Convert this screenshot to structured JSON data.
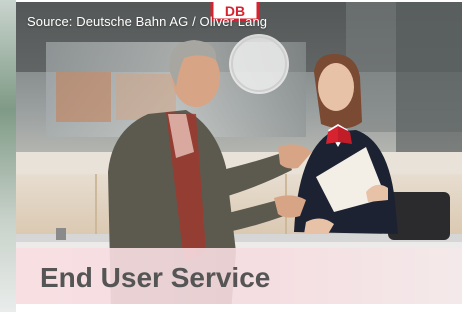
{
  "photo": {
    "source_credit": "Source: Deutsche Bahn AG / Oliver Lang",
    "logo_text": "DB",
    "colors": {
      "accent_red": "#d7232f",
      "banner_tint": "#f6dce0",
      "title_grey": "#555555"
    }
  },
  "banner": {
    "title": "End User Service"
  }
}
